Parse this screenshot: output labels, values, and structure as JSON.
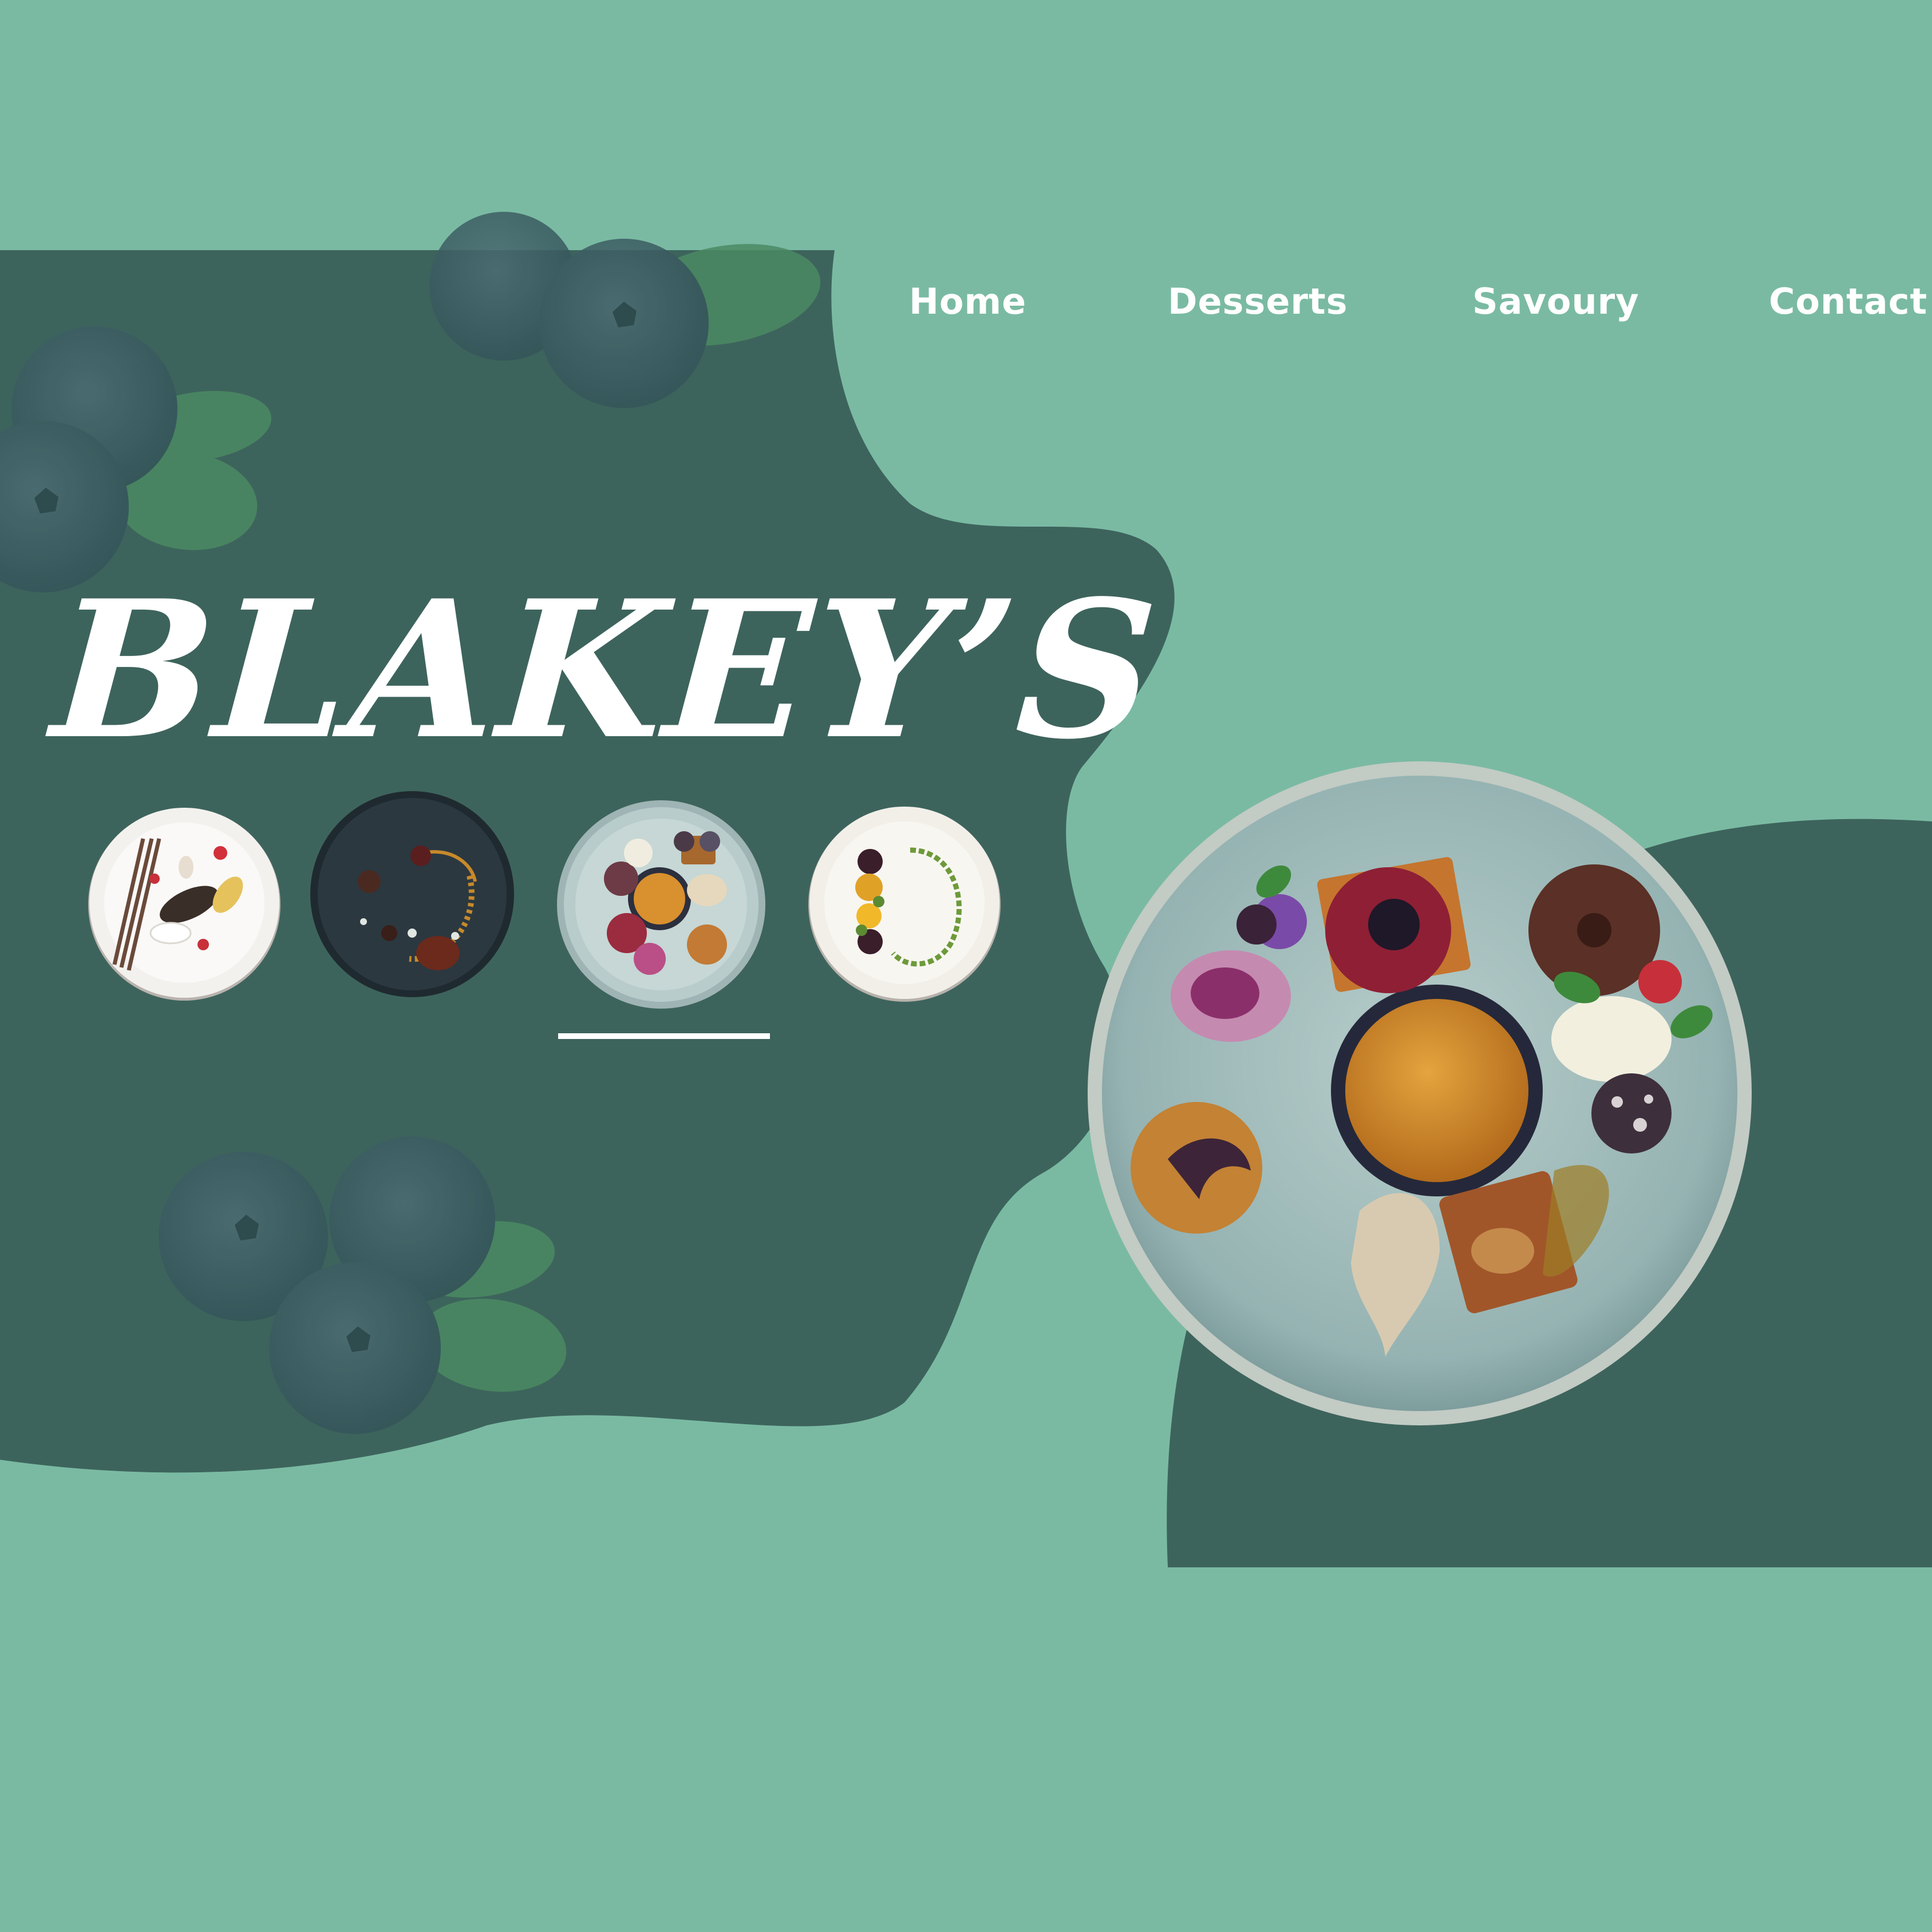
{
  "colors": {
    "background": "#7abaa3",
    "dark_panel": "#3d645c",
    "text": "#ffffff"
  },
  "navigation": {
    "items": [
      {
        "label": "Home"
      },
      {
        "label": "Desserts"
      },
      {
        "label": "Savoury"
      },
      {
        "label": "Contact"
      }
    ]
  },
  "brand": {
    "name": "BLAKEY’S"
  },
  "gallery": {
    "thumbnails": [
      {
        "icon": "white-plate-dessert-thumbnail"
      },
      {
        "icon": "dark-plate-dessert-thumbnail"
      },
      {
        "icon": "blue-plate-dessert-thumbnail",
        "selected": true
      },
      {
        "icon": "white-plate-beetroot-thumbnail"
      }
    ],
    "selected_index": 2
  },
  "hero": {
    "icon": "dessert-platter-image"
  },
  "decorations": {
    "icons": [
      "blueberry-icon"
    ]
  }
}
